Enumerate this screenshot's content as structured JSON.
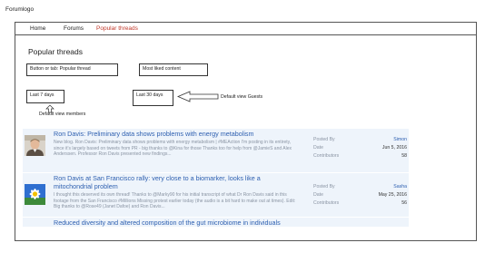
{
  "logo": "Forumlogo",
  "nav": {
    "items": [
      "Home",
      "Forums",
      "Popular threads"
    ],
    "active_index": 2
  },
  "main": {
    "title": "Popular threads",
    "boxes": {
      "popular_thread": "Button or tab: Popular thread",
      "most_liked": "Most liked content",
      "last_7_days": "Last 7 days",
      "last_30_days": "Last 30 days"
    },
    "notes": {
      "default_members": "Default view members",
      "default_guests": "Default view Guests"
    }
  },
  "threads": [
    {
      "title": "Ron Davis: Preliminary data shows problems with energy metabolism",
      "snippet": "New blog. Ron Davis: Preliminary data shows problems with energy metabolism | #MEAction I'm posting in its entirety, since it's largely based on tweets from PR - big thanks to @Kina for those Thanks too for help from @JamieS and Alex Anderssen. Professor Ron Davis presented new findings...",
      "avatar": "person-photo",
      "posted_by_label": "Posted By",
      "posted_by": "Simon",
      "date_label": "Date",
      "date": "Jun 5, 2016",
      "contributors_label": "Contributors",
      "contributors": "58"
    },
    {
      "title": "Ron Davis at San Francisco rally: very close to a biomarker, looks like a mitochondrial problem",
      "snippet": "I thought this deserved its own thread! Thanks to @Marky90 for his initial transcript of what Dr Ron Davis said in this footage from the San Francisco #Millions Missing protest earlier today (the audio is a bit hard to make out at times). Edit: Big thanks to @Rose49 (Janet Dafoe) and Ron Davis...",
      "avatar": "daisy-flower",
      "posted_by_label": "Posted By",
      "posted_by": "Sasha",
      "date_label": "Date",
      "date": "May 25, 2016",
      "contributors_label": "Contributors",
      "contributors": "56"
    },
    {
      "title": "Reduced diversity and altered composition of the gut microbiome in individuals"
    }
  ],
  "colors": {
    "accent_red": "#c0392b",
    "link_blue": "#2d5fb0",
    "row_bg": "#eef4fb",
    "muted": "#8a94a3"
  }
}
